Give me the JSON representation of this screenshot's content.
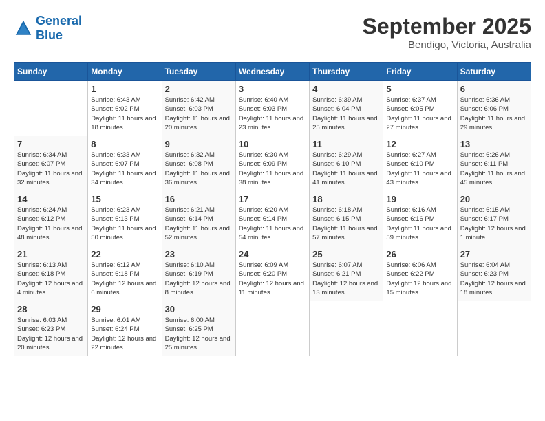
{
  "header": {
    "logo_line1": "General",
    "logo_line2": "Blue",
    "month": "September 2025",
    "location": "Bendigo, Victoria, Australia"
  },
  "days_of_week": [
    "Sunday",
    "Monday",
    "Tuesday",
    "Wednesday",
    "Thursday",
    "Friday",
    "Saturday"
  ],
  "weeks": [
    [
      {
        "day": "",
        "sunrise": "",
        "sunset": "",
        "daylight": ""
      },
      {
        "day": "1",
        "sunrise": "Sunrise: 6:43 AM",
        "sunset": "Sunset: 6:02 PM",
        "daylight": "Daylight: 11 hours and 18 minutes."
      },
      {
        "day": "2",
        "sunrise": "Sunrise: 6:42 AM",
        "sunset": "Sunset: 6:03 PM",
        "daylight": "Daylight: 11 hours and 20 minutes."
      },
      {
        "day": "3",
        "sunrise": "Sunrise: 6:40 AM",
        "sunset": "Sunset: 6:03 PM",
        "daylight": "Daylight: 11 hours and 23 minutes."
      },
      {
        "day": "4",
        "sunrise": "Sunrise: 6:39 AM",
        "sunset": "Sunset: 6:04 PM",
        "daylight": "Daylight: 11 hours and 25 minutes."
      },
      {
        "day": "5",
        "sunrise": "Sunrise: 6:37 AM",
        "sunset": "Sunset: 6:05 PM",
        "daylight": "Daylight: 11 hours and 27 minutes."
      },
      {
        "day": "6",
        "sunrise": "Sunrise: 6:36 AM",
        "sunset": "Sunset: 6:06 PM",
        "daylight": "Daylight: 11 hours and 29 minutes."
      }
    ],
    [
      {
        "day": "7",
        "sunrise": "Sunrise: 6:34 AM",
        "sunset": "Sunset: 6:07 PM",
        "daylight": "Daylight: 11 hours and 32 minutes."
      },
      {
        "day": "8",
        "sunrise": "Sunrise: 6:33 AM",
        "sunset": "Sunset: 6:07 PM",
        "daylight": "Daylight: 11 hours and 34 minutes."
      },
      {
        "day": "9",
        "sunrise": "Sunrise: 6:32 AM",
        "sunset": "Sunset: 6:08 PM",
        "daylight": "Daylight: 11 hours and 36 minutes."
      },
      {
        "day": "10",
        "sunrise": "Sunrise: 6:30 AM",
        "sunset": "Sunset: 6:09 PM",
        "daylight": "Daylight: 11 hours and 38 minutes."
      },
      {
        "day": "11",
        "sunrise": "Sunrise: 6:29 AM",
        "sunset": "Sunset: 6:10 PM",
        "daylight": "Daylight: 11 hours and 41 minutes."
      },
      {
        "day": "12",
        "sunrise": "Sunrise: 6:27 AM",
        "sunset": "Sunset: 6:10 PM",
        "daylight": "Daylight: 11 hours and 43 minutes."
      },
      {
        "day": "13",
        "sunrise": "Sunrise: 6:26 AM",
        "sunset": "Sunset: 6:11 PM",
        "daylight": "Daylight: 11 hours and 45 minutes."
      }
    ],
    [
      {
        "day": "14",
        "sunrise": "Sunrise: 6:24 AM",
        "sunset": "Sunset: 6:12 PM",
        "daylight": "Daylight: 11 hours and 48 minutes."
      },
      {
        "day": "15",
        "sunrise": "Sunrise: 6:23 AM",
        "sunset": "Sunset: 6:13 PM",
        "daylight": "Daylight: 11 hours and 50 minutes."
      },
      {
        "day": "16",
        "sunrise": "Sunrise: 6:21 AM",
        "sunset": "Sunset: 6:14 PM",
        "daylight": "Daylight: 11 hours and 52 minutes."
      },
      {
        "day": "17",
        "sunrise": "Sunrise: 6:20 AM",
        "sunset": "Sunset: 6:14 PM",
        "daylight": "Daylight: 11 hours and 54 minutes."
      },
      {
        "day": "18",
        "sunrise": "Sunrise: 6:18 AM",
        "sunset": "Sunset: 6:15 PM",
        "daylight": "Daylight: 11 hours and 57 minutes."
      },
      {
        "day": "19",
        "sunrise": "Sunrise: 6:16 AM",
        "sunset": "Sunset: 6:16 PM",
        "daylight": "Daylight: 11 hours and 59 minutes."
      },
      {
        "day": "20",
        "sunrise": "Sunrise: 6:15 AM",
        "sunset": "Sunset: 6:17 PM",
        "daylight": "Daylight: 12 hours and 1 minute."
      }
    ],
    [
      {
        "day": "21",
        "sunrise": "Sunrise: 6:13 AM",
        "sunset": "Sunset: 6:18 PM",
        "daylight": "Daylight: 12 hours and 4 minutes."
      },
      {
        "day": "22",
        "sunrise": "Sunrise: 6:12 AM",
        "sunset": "Sunset: 6:18 PM",
        "daylight": "Daylight: 12 hours and 6 minutes."
      },
      {
        "day": "23",
        "sunrise": "Sunrise: 6:10 AM",
        "sunset": "Sunset: 6:19 PM",
        "daylight": "Daylight: 12 hours and 8 minutes."
      },
      {
        "day": "24",
        "sunrise": "Sunrise: 6:09 AM",
        "sunset": "Sunset: 6:20 PM",
        "daylight": "Daylight: 12 hours and 11 minutes."
      },
      {
        "day": "25",
        "sunrise": "Sunrise: 6:07 AM",
        "sunset": "Sunset: 6:21 PM",
        "daylight": "Daylight: 12 hours and 13 minutes."
      },
      {
        "day": "26",
        "sunrise": "Sunrise: 6:06 AM",
        "sunset": "Sunset: 6:22 PM",
        "daylight": "Daylight: 12 hours and 15 minutes."
      },
      {
        "day": "27",
        "sunrise": "Sunrise: 6:04 AM",
        "sunset": "Sunset: 6:23 PM",
        "daylight": "Daylight: 12 hours and 18 minutes."
      }
    ],
    [
      {
        "day": "28",
        "sunrise": "Sunrise: 6:03 AM",
        "sunset": "Sunset: 6:23 PM",
        "daylight": "Daylight: 12 hours and 20 minutes."
      },
      {
        "day": "29",
        "sunrise": "Sunrise: 6:01 AM",
        "sunset": "Sunset: 6:24 PM",
        "daylight": "Daylight: 12 hours and 22 minutes."
      },
      {
        "day": "30",
        "sunrise": "Sunrise: 6:00 AM",
        "sunset": "Sunset: 6:25 PM",
        "daylight": "Daylight: 12 hours and 25 minutes."
      },
      {
        "day": "",
        "sunrise": "",
        "sunset": "",
        "daylight": ""
      },
      {
        "day": "",
        "sunrise": "",
        "sunset": "",
        "daylight": ""
      },
      {
        "day": "",
        "sunrise": "",
        "sunset": "",
        "daylight": ""
      },
      {
        "day": "",
        "sunrise": "",
        "sunset": "",
        "daylight": ""
      }
    ]
  ]
}
